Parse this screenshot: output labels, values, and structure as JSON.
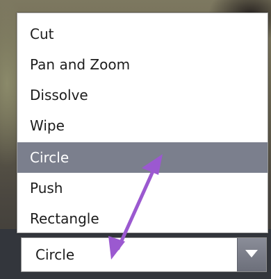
{
  "dropdown": {
    "options": [
      "Cut",
      "Pan and Zoom",
      "Dissolve",
      "Wipe",
      "Circle",
      "Push",
      "Rectangle"
    ],
    "highlighted": "Circle",
    "selected_value": "Circle",
    "button_icon": "chevron-down-icon"
  },
  "annotation": {
    "icon": "double-headed-arrow",
    "color": "#9b59d0"
  },
  "colors": {
    "highlight": "#7b7f8d",
    "menu_bg": "#ffffff",
    "text": "#1c1c1c"
  }
}
